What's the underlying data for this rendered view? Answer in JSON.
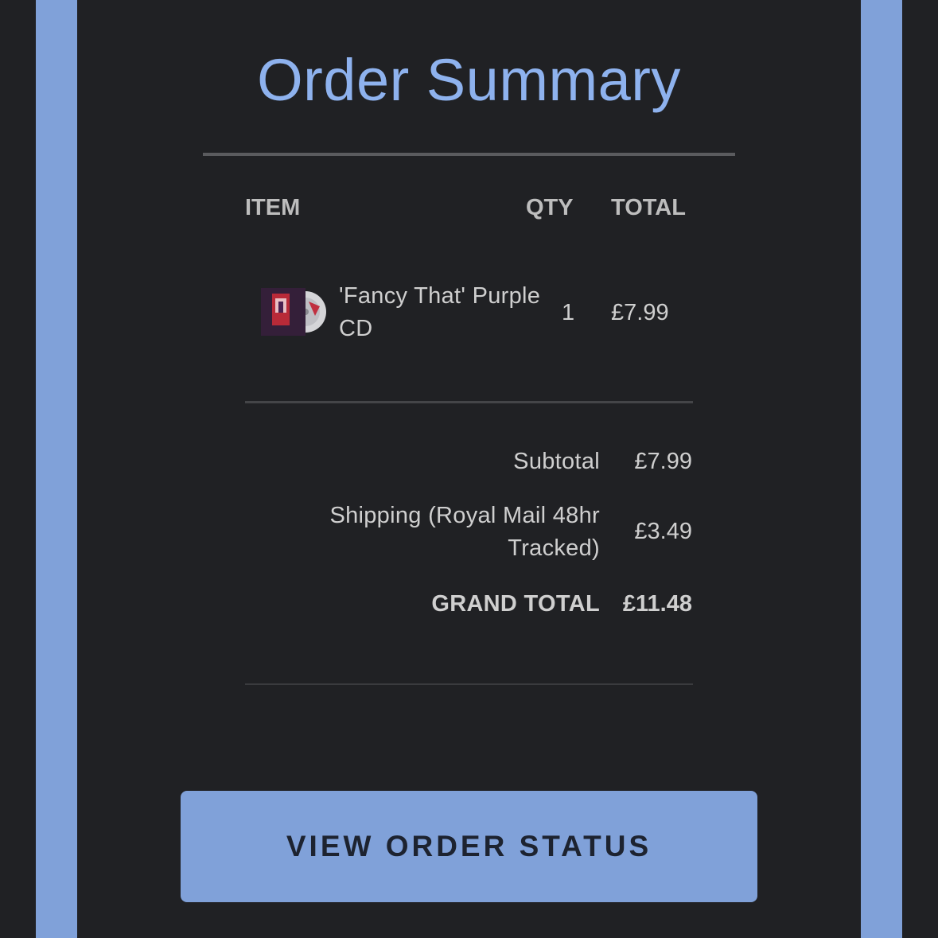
{
  "header": {
    "title": "Order Summary"
  },
  "table": {
    "columns": [
      "ITEM",
      "QTY",
      "TOTAL"
    ],
    "rows": [
      {
        "thumbnail": "album-cd-thumbnail",
        "name": "'Fancy That' Purple CD",
        "qty": "1",
        "total": "£7.99"
      }
    ]
  },
  "summary": {
    "subtotal_label": "Subtotal",
    "subtotal_value": "£7.99",
    "shipping_label": "Shipping (Royal Mail 48hr Tracked)",
    "shipping_value": "£3.49",
    "grand_total_label": "GRAND TOTAL",
    "grand_total_value": "£11.48"
  },
  "cta": {
    "label": "VIEW ORDER STATUS"
  },
  "colors": {
    "background": "#202124",
    "accent": "#80a1d9",
    "title": "#8eb2ee",
    "text": "#cfcfcf"
  }
}
